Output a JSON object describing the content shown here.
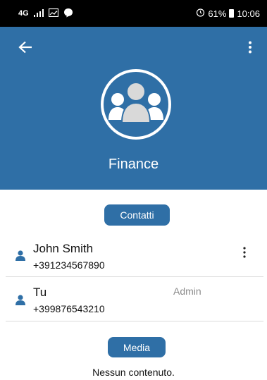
{
  "status_bar": {
    "network": "4G",
    "battery_percent": "61%",
    "time": "10:06",
    "icons": [
      "signal-icon",
      "gallery-icon",
      "chat-bubble-icon",
      "alarm-icon",
      "battery-icon"
    ]
  },
  "header": {
    "background_color": "#2f6fa6",
    "group_name": "Finance",
    "icons": [
      "back-arrow-icon",
      "more-vertical-icon",
      "group-avatar-icon"
    ]
  },
  "contacts_section": {
    "button_label": "Contatti",
    "contacts": [
      {
        "name": "John Smith",
        "phone": "+391234567890",
        "role": "",
        "has_menu": true
      },
      {
        "name": "Tu",
        "phone": "+399876543210",
        "role": "Admin",
        "has_menu": false
      }
    ]
  },
  "media_section": {
    "button_label": "Media",
    "empty_text": "Nessun contenuto."
  },
  "accent_color": "#2f6fa6"
}
